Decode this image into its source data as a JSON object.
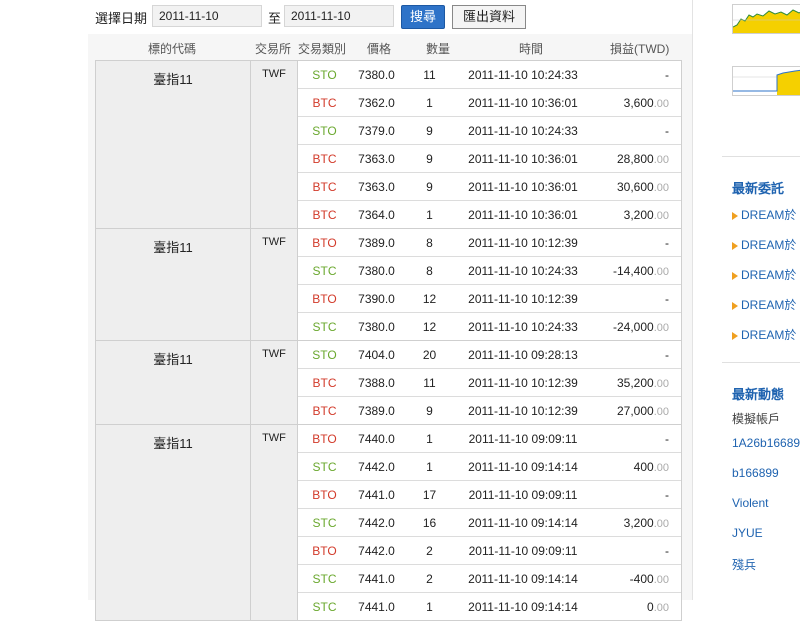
{
  "filter": {
    "label": "選擇日期",
    "date_from": "2011-11-10",
    "separator": "至",
    "date_to": "2011-11-10",
    "search_label": "搜尋",
    "export_label": "匯出資料"
  },
  "table": {
    "headers": {
      "symbol": "標的代碼",
      "exchange": "交易所",
      "type": "交易類別",
      "price": "價格",
      "qty": "數量",
      "time": "時間",
      "pnl": "損益(TWD)"
    },
    "groups": [
      {
        "symbol": "臺指11",
        "exchange": "TWF",
        "rows": [
          {
            "type": "STO",
            "price": "7380.0",
            "qty": "11",
            "time": "2011-11-10 10:24:33",
            "pnl": "-",
            "dec": ""
          },
          {
            "type": "BTC",
            "price": "7362.0",
            "qty": "1",
            "time": "2011-11-10 10:36:01",
            "pnl": "3,600",
            "dec": ".00"
          },
          {
            "type": "STO",
            "price": "7379.0",
            "qty": "9",
            "time": "2011-11-10 10:24:33",
            "pnl": "-",
            "dec": ""
          },
          {
            "type": "BTC",
            "price": "7363.0",
            "qty": "9",
            "time": "2011-11-10 10:36:01",
            "pnl": "28,800",
            "dec": ".00"
          },
          {
            "type": "BTC",
            "price": "7363.0",
            "qty": "9",
            "time": "2011-11-10 10:36:01",
            "pnl": "30,600",
            "dec": ".00"
          },
          {
            "type": "BTC",
            "price": "7364.0",
            "qty": "1",
            "time": "2011-11-10 10:36:01",
            "pnl": "3,200",
            "dec": ".00"
          }
        ]
      },
      {
        "symbol": "臺指11",
        "exchange": "TWF",
        "rows": [
          {
            "type": "BTO",
            "price": "7389.0",
            "qty": "8",
            "time": "2011-11-10 10:12:39",
            "pnl": "-",
            "dec": ""
          },
          {
            "type": "STC",
            "price": "7380.0",
            "qty": "8",
            "time": "2011-11-10 10:24:33",
            "pnl": "-14,400",
            "dec": ".00"
          },
          {
            "type": "BTO",
            "price": "7390.0",
            "qty": "12",
            "time": "2011-11-10 10:12:39",
            "pnl": "-",
            "dec": ""
          },
          {
            "type": "STC",
            "price": "7380.0",
            "qty": "12",
            "time": "2011-11-10 10:24:33",
            "pnl": "-24,000",
            "dec": ".00"
          }
        ]
      },
      {
        "symbol": "臺指11",
        "exchange": "TWF",
        "rows": [
          {
            "type": "STO",
            "price": "7404.0",
            "qty": "20",
            "time": "2011-11-10 09:28:13",
            "pnl": "-",
            "dec": ""
          },
          {
            "type": "BTC",
            "price": "7388.0",
            "qty": "11",
            "time": "2011-11-10 10:12:39",
            "pnl": "35,200",
            "dec": ".00"
          },
          {
            "type": "BTC",
            "price": "7389.0",
            "qty": "9",
            "time": "2011-11-10 10:12:39",
            "pnl": "27,000",
            "dec": ".00"
          }
        ]
      },
      {
        "symbol": "臺指11",
        "exchange": "TWF",
        "rows": [
          {
            "type": "BTO",
            "price": "7440.0",
            "qty": "1",
            "time": "2011-11-10 09:09:11",
            "pnl": "-",
            "dec": ""
          },
          {
            "type": "STC",
            "price": "7442.0",
            "qty": "1",
            "time": "2011-11-10 09:14:14",
            "pnl": "400",
            "dec": ".00"
          },
          {
            "type": "BTO",
            "price": "7441.0",
            "qty": "17",
            "time": "2011-11-10 09:09:11",
            "pnl": "-",
            "dec": ""
          },
          {
            "type": "STC",
            "price": "7442.0",
            "qty": "16",
            "time": "2011-11-10 09:14:14",
            "pnl": "3,200",
            "dec": ".00"
          },
          {
            "type": "BTO",
            "price": "7442.0",
            "qty": "2",
            "time": "2011-11-10 09:09:11",
            "pnl": "-",
            "dec": ""
          },
          {
            "type": "STC",
            "price": "7441.0",
            "qty": "2",
            "time": "2011-11-10 09:14:14",
            "pnl": "-400",
            "dec": ".00"
          },
          {
            "type": "STC",
            "price": "7441.0",
            "qty": "1",
            "time": "2011-11-10 09:14:14",
            "pnl": "0",
            "dec": ".00"
          }
        ]
      }
    ]
  },
  "sidebar": {
    "latest_orders_title": "最新委託",
    "latest_orders": [
      "DREAM於",
      "DREAM於",
      "DREAM於",
      "DREAM於",
      "DREAM於"
    ],
    "latest_activity_title": "最新動態",
    "activity_heading": "模擬帳戶",
    "activity_items": [
      "1A26b16689",
      "b166899",
      "Violent",
      "JYUE",
      "殘兵"
    ]
  },
  "colors": {
    "accent_blue": "#2e73c8",
    "open_green": "#6aa82e",
    "close_red": "#d23a2a",
    "chart_fill": "#f5d000"
  }
}
